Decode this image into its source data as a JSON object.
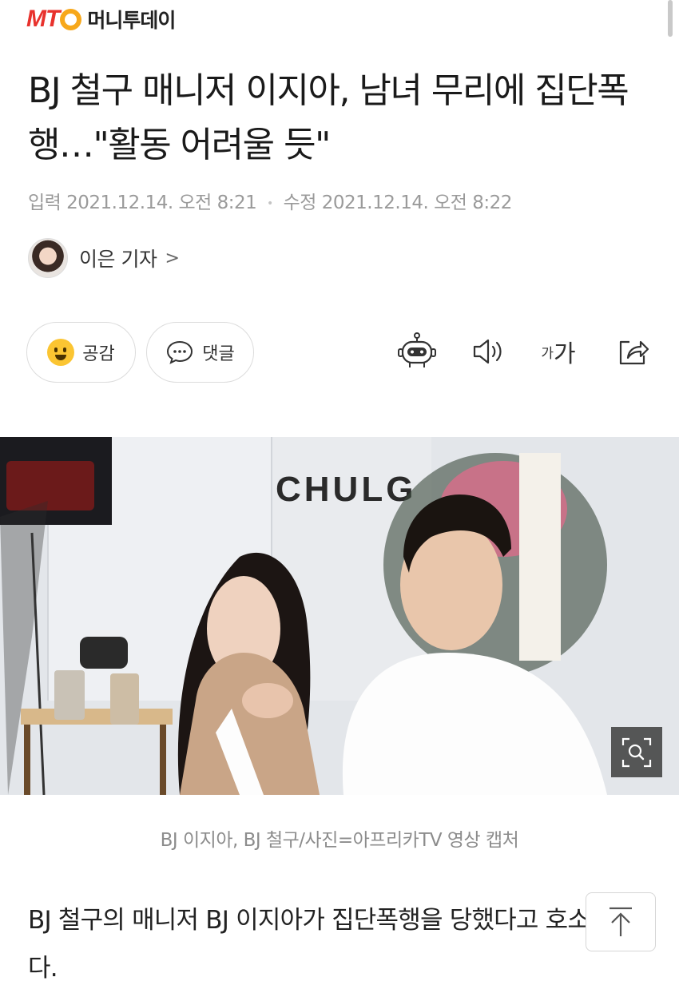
{
  "header": {
    "logo_mark": "MT",
    "logo_name": "머니투데이"
  },
  "article": {
    "title": "BJ 철구 매니저 이지아, 남녀 무리에 집단폭행…\"활동 어려울 듯\"",
    "meta": {
      "published_label": "입력",
      "published": "2021.12.14. 오전 8:21",
      "modified_label": "수정",
      "modified": "2021.12.14. 오전 8:22"
    },
    "author": {
      "name": "이은 기자",
      "chevron": ">"
    },
    "actions": {
      "like_label": "공감",
      "comment_label": "댓글",
      "font_small": "가",
      "font_large": "가"
    },
    "photo": {
      "overlay_text": "CHULG",
      "caption": "BJ 이지아, BJ 철구/사진=아프리카TV 영상 캡처"
    },
    "body": "BJ 철구의 매니저 BJ 이지아가 집단폭행을 당했다고 호소했다."
  },
  "icons": {
    "robot": "robot-icon",
    "speaker": "speaker-icon",
    "share": "share-icon",
    "zoom": "zoom-icon",
    "arrow_up": "arrow-up-icon",
    "emoji": "smile-emoji-icon",
    "comment": "comment-bubble-icon"
  },
  "colors": {
    "brand_red": "#e8322d",
    "brand_orange": "#f7a81b",
    "emoji_yellow": "#fbc532"
  }
}
